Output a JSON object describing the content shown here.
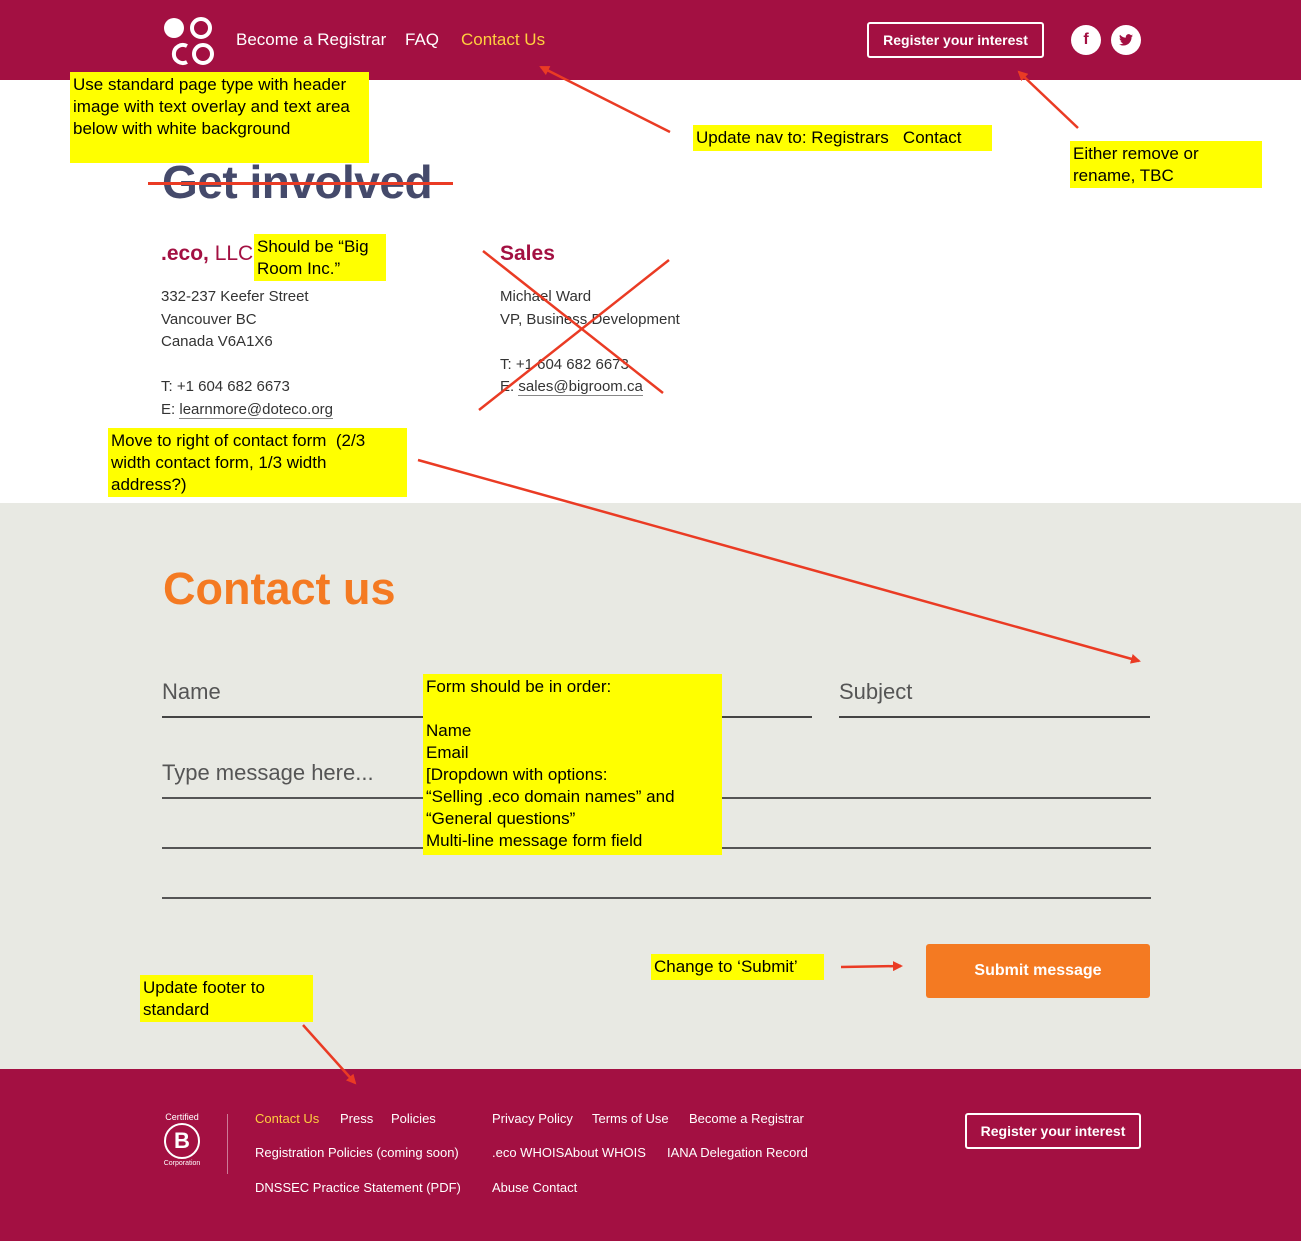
{
  "header": {
    "logo_text": ".eco",
    "nav": [
      "Become a Registrar",
      "FAQ",
      "Contact Us"
    ],
    "register_button": "Register your interest",
    "social": [
      {
        "icon": "facebook-icon",
        "glyph": "f"
      },
      {
        "icon": "twitter-icon",
        "glyph": "t"
      }
    ]
  },
  "main": {
    "heading": "Get involved",
    "company": {
      "title_bold": ".eco,",
      "title_thin": "LLC",
      "address": [
        "332-237 Keefer Street",
        "Vancouver BC",
        "Canada V6A1X6"
      ],
      "phone": "T: +1 604 682 6673",
      "email_prefix": "E:",
      "email": "learnmore@doteco.org"
    },
    "sales": {
      "title": "Sales",
      "name": "Michael Ward",
      "role": "VP, Business Development",
      "phone": "T: +1 604 682 6673",
      "email_prefix": "E:",
      "email": "sales@bigroom.ca"
    }
  },
  "contact_form": {
    "title": "Contact us",
    "name_placeholder": "Name",
    "subject_placeholder": "Subject",
    "message_placeholder": "Type message here...",
    "submit_label": "Submit message"
  },
  "footer": {
    "bcorp": {
      "top": "Certified",
      "letter": "B",
      "bottom": "Corporation"
    },
    "links": {
      "contact_us": "Contact Us",
      "press": "Press",
      "policies": "Policies",
      "privacy_policy": "Privacy Policy",
      "terms_of_use": "Terms of Use",
      "become_registrar": "Become a Registrar",
      "registration_policies": "Registration Policies (coming soon)",
      "whois": ".eco WHOISAbout WHOIS",
      "iana": "IANA Delegation Record",
      "dnssec": "DNSSEC Practice Statement (PDF)",
      "abuse_contact": "Abuse Contact"
    },
    "register_button": "Register your interest"
  },
  "annotations": {
    "header_image": "Use standard page type with header image with text overlay and text area below with white background",
    "update_nav": "Update nav to: Registrars   Contact",
    "remove_rename": "Either remove or rename, TBC",
    "big_room": "Should be “Big Room Inc.”",
    "move_right": "Move to right of contact form  (2/3 width contact form, 1/3 width address?)",
    "form_order": "Form should be in order:\n\nName\nEmail\n[Dropdown with options:\n“Selling .eco domain names” and\n“General questions”\nMulti-line message form field",
    "change_submit": "Change to ‘Submit’",
    "update_footer": "Update footer to standard"
  },
  "colors": {
    "brand": "#a31042",
    "accent_orange": "#f47a22",
    "nav_active": "#ffcf3e",
    "annotation_bg": "#ffff00",
    "annotation_arrow": "#ea3b24",
    "form_bg": "#e8e9e3"
  }
}
